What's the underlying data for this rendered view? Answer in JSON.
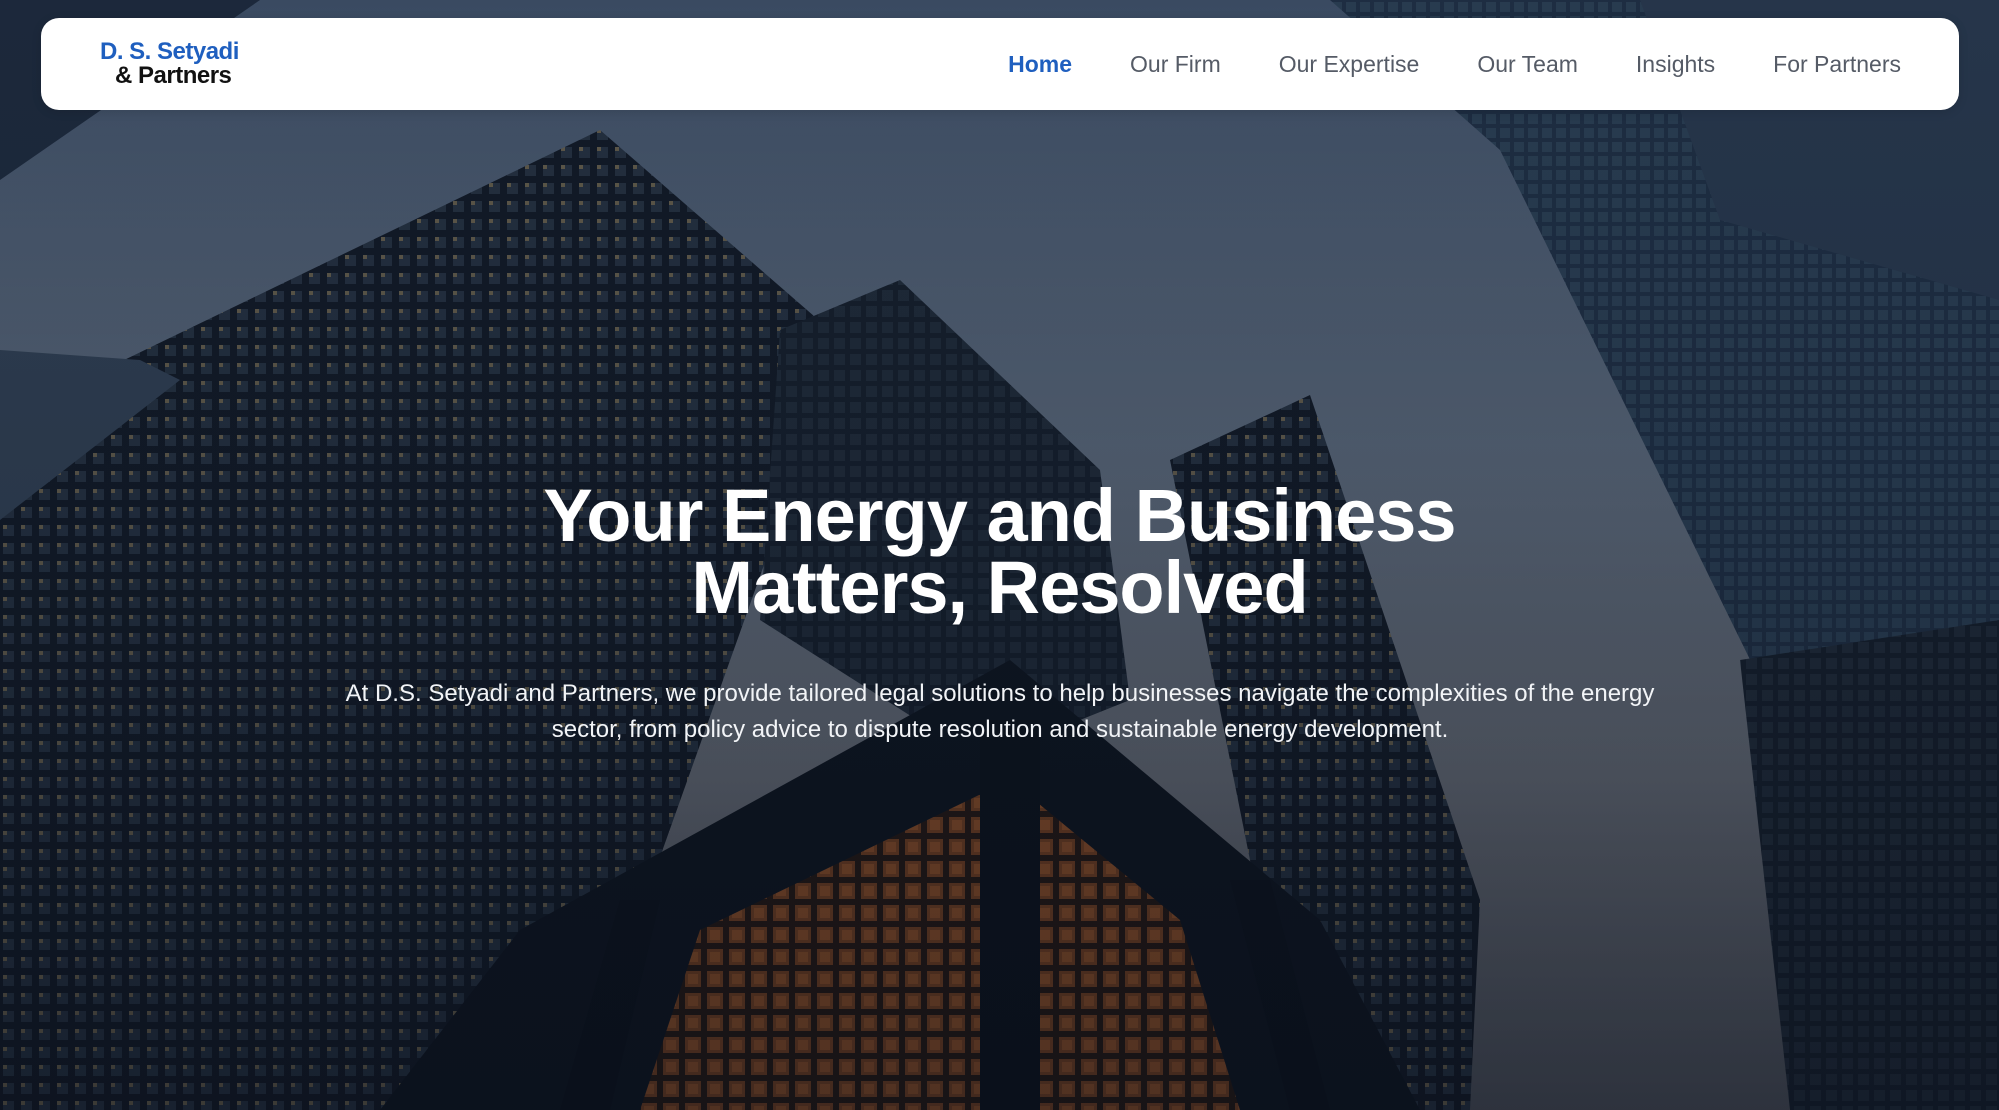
{
  "brand": {
    "line1": "D. S. Setyadi",
    "line2": "& Partners",
    "accent_color": "#1f5fbf"
  },
  "nav": {
    "items": [
      {
        "label": "Home",
        "active": true
      },
      {
        "label": "Our Firm",
        "active": false
      },
      {
        "label": "Our Expertise",
        "active": false
      },
      {
        "label": "Our Team",
        "active": false
      },
      {
        "label": "Insights",
        "active": false
      },
      {
        "label": "For Partners",
        "active": false
      }
    ]
  },
  "hero": {
    "title_line1": "Your Energy and Business",
    "title_line2": "Matters, Resolved",
    "subtitle": "At D.S. Setyadi and Partners, we provide tailored legal solutions to help businesses navigate the complexities of the energy sector, from policy advice to dispute resolution and sustainable energy development.",
    "background_image": "skyscrapers-low-angle-photo"
  }
}
